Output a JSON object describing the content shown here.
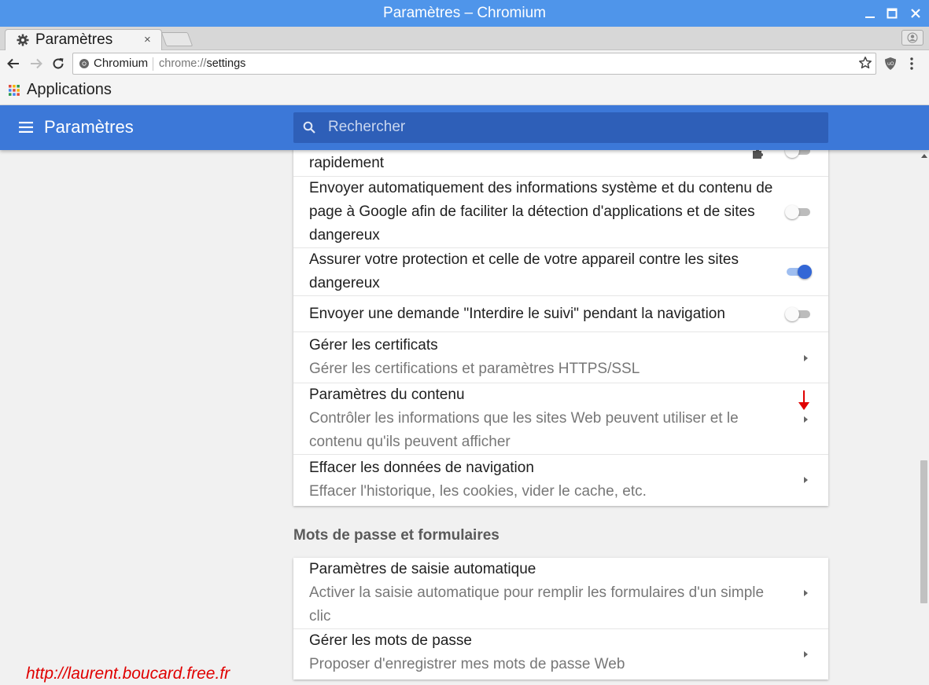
{
  "window": {
    "title": "Paramètres – Chromium"
  },
  "tab": {
    "title": "Paramètres",
    "close_glyph": "×"
  },
  "omnibox": {
    "site_chip": "Chromium",
    "url_scheme": "chrome://",
    "url_path": "settings"
  },
  "bookmarks": {
    "apps_label": "Applications"
  },
  "header": {
    "title": "Paramètres",
    "search_placeholder": "Rechercher"
  },
  "privacy_rows": [
    {
      "label": "rapidement",
      "toggle": false
    },
    {
      "label": "Envoyer automatiquement des informations système et du contenu de page à Google afin de faciliter la détection d'applications et de sites dangereux",
      "toggle": false
    },
    {
      "label": "Assurer votre protection et celle de votre appareil contre les sites dangereux",
      "toggle": true
    },
    {
      "label": "Envoyer une demande \"Interdire le suivi\" pendant la navigation",
      "toggle": false
    },
    {
      "label": "Gérer les certificats",
      "sublabel": "Gérer les certifications et paramètres HTTPS/SSL"
    },
    {
      "label": "Paramètres du contenu",
      "sublabel": "Contrôler les informations que les sites Web peuvent utiliser et le contenu qu'ils peuvent afficher"
    },
    {
      "label": "Effacer les données de navigation",
      "sublabel": "Effacer l'historique, les cookies, vider le cache, etc."
    }
  ],
  "passwords_section": {
    "title": "Mots de passe et formulaires",
    "rows": [
      {
        "label": "Paramètres de saisie automatique",
        "sublabel": "Activer la saisie automatique pour remplir les formulaires d'un simple clic"
      },
      {
        "label": "Gérer les mots de passe",
        "sublabel": "Proposer d'enregistrer mes mots de passe Web"
      }
    ]
  },
  "watermark": "http://laurent.boucard.free.fr",
  "colors": {
    "title_bar": "#4f95ea",
    "header": "#3c78d8",
    "search_box": "#2e5fb8",
    "toggle_on": "#3367d6",
    "annotation": "#e00000"
  },
  "icons": [
    "gear-icon",
    "close-icon",
    "back-icon",
    "forward-icon",
    "reload-icon",
    "star-icon",
    "ublock-icon",
    "kebab-menu-icon",
    "apps-grid-icon",
    "hamburger-icon",
    "search-icon",
    "puzzle-icon",
    "chevron-right-icon",
    "red-down-arrow"
  ]
}
